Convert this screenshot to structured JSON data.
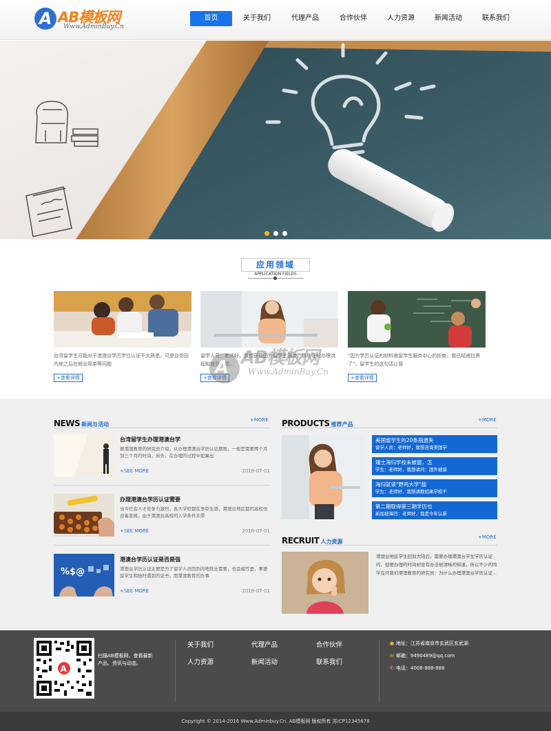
{
  "header": {
    "logo": {
      "name": "AB模板网",
      "sub": "Www.AdminBuy.Cn",
      "mark": "A"
    },
    "nav": [
      {
        "label": "首页",
        "active": true
      },
      {
        "label": "关于我们",
        "active": false
      },
      {
        "label": "代理产品",
        "active": false
      },
      {
        "label": "合作伙伴",
        "active": false
      },
      {
        "label": "人力资源",
        "active": false
      },
      {
        "label": "新闻活动",
        "active": false
      },
      {
        "label": "联系我们",
        "active": false
      }
    ],
    "accent_color": "#1a73e8"
  },
  "banner": {
    "slides": 3,
    "active_slide": 1,
    "dot_active_color": "#f3b81f"
  },
  "application": {
    "title": "应用领域",
    "subtitle": "APPLICATION FIELDS",
    "cards": [
      {
        "text": "台湾留学生可能对于港澳台学历学位认证不太熟悉，可是台你回内地之后在就业简单等问题",
        "more": "+查看详情"
      },
      {
        "text": "留学人员：老师好，我想获得国外留学生服务，那认证的办理流程和就业问题…",
        "more": "+查看详情"
      },
      {
        "text": "\"因为学历认证的材料被留学生服务中心的拒绝，我已经被拉黑了\"，留学生的这句话让我",
        "more": "+查看详情"
      }
    ]
  },
  "news": {
    "title": "NEWS",
    "subtitle": "新闻与活动",
    "more": "+MORE",
    "items": [
      {
        "title": "台湾留学生办理港澳台学",
        "desc": "据港澳教育的研究员介绍，从办理港澳台学历认证期限，一般是需要两个月到三个月的时间，另外，在办理的过程中如果出",
        "more": "+SEE MORE",
        "date": "2016-07-01"
      },
      {
        "title": "办理港澳台学历认证需要",
        "desc": "当今社会人才竞争力激烈，各大学校都在争夺生源，港澳台地区都的高校也迎着发展，由于港澳台高校的入学条件丰厚",
        "more": "+SEE MORE",
        "date": "2016-07-01"
      },
      {
        "title": "港澳台学历认证是否是强",
        "desc": "港澳台学历认证主要是为了留学人员回到内地就业需要，也会编写里，事更留学生和随时遇到的证书，而港澳教育的办事",
        "more": "+SEE MORE",
        "date": "2016-07-01"
      }
    ]
  },
  "products": {
    "title": "PRODUCTS",
    "subtitle": "推荐产品",
    "more": "+MORE",
    "items": [
      {
        "title": "美国留学生的20条指遗失",
        "sub": "留学人员：老师好，我想咨询美国学"
      },
      {
        "title": "瑞士海归学校未被留，怎",
        "sub": "学生：老师好，我想请问：国外被留"
      },
      {
        "title": "海归就读\"野鸡大学\"能",
        "sub": "学生：老师好，我想请教如果学校不"
      },
      {
        "title": "第二期取得第三期学历也",
        "sub": "新加坡海归：老师好，我是今年认新"
      }
    ]
  },
  "recruit": {
    "title": "RECRUIT",
    "subtitle": "人力资源",
    "more": "+MORE",
    "text": "港澳台地区学生回到大陆后，需要办理港澳台学生学历认证的。但要办理的时间却没有办法很清晰的知道，所以不少的同学在问我们港澳教育的研究员：为什么办理港澳台学历认证..."
  },
  "footer": {
    "qr_text": "扫描AB模板网，查看最新产品、资讯与动态。",
    "links": [
      "关于我们",
      "代理产品",
      "合作伙伴",
      "人力资源",
      "新闻活动",
      "联系我们"
    ],
    "contact": [
      {
        "icon": "location-icon",
        "text": "地址：江苏省南京市玄武区玄武湖"
      },
      {
        "icon": "mail-icon",
        "text": "邮箱：9490489@qq.com"
      },
      {
        "icon": "phone-icon",
        "text": "电话：4008-888-888"
      }
    ],
    "copyright": "Copyright © 2014-2016 Www.Adminbuy.Cn. AB模板网 版权所有    苏ICP12345678"
  },
  "watermark": {
    "name": "AB模板网",
    "url": "Www.AdminBuy.Cn"
  }
}
